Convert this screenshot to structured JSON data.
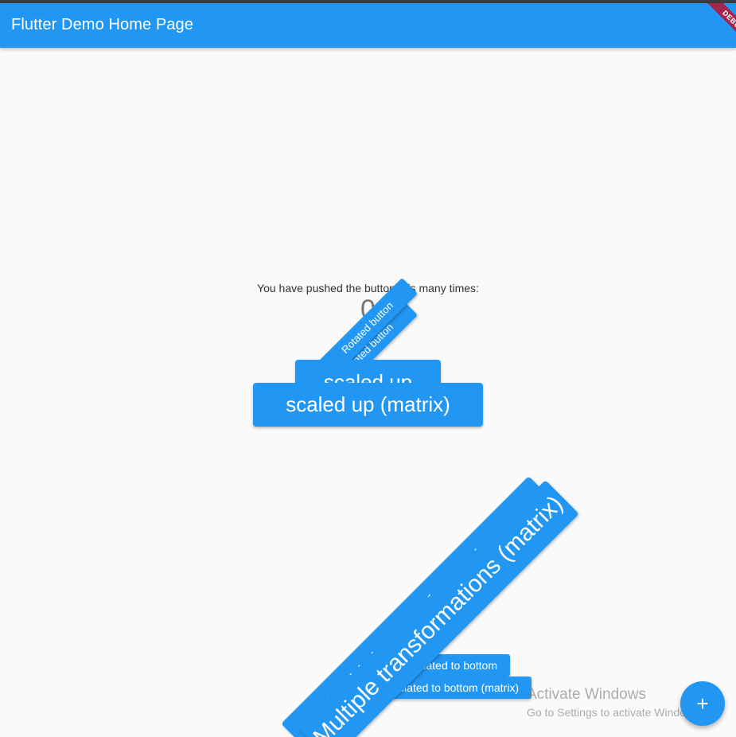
{
  "app": {
    "title": "Flutter Demo Home Page",
    "debug_banner": "DEBUG"
  },
  "counter": {
    "label": "You have pushed the button this many times:",
    "value": "0"
  },
  "buttons": {
    "rotated": "Rotated button",
    "rotated_matrix": "Rotated button",
    "scaled_up": "scaled up",
    "scaled_up_matrix": "scaled up (matrix)",
    "translated": "Translated to bottom",
    "translated_matrix": "Translated to bottom (matrix)",
    "multiple": "Multiple transformations",
    "multiple_matrix": "Multiple transformations (matrix)"
  },
  "fab": {
    "icon": "add-icon",
    "glyph": "+"
  },
  "watermark": {
    "title": "Activate Windows",
    "subtitle": "Go to Settings to activate Windows."
  },
  "colors": {
    "primary": "#2196f3",
    "background": "#fafafa",
    "debug_ribbon": "#a4254d"
  }
}
